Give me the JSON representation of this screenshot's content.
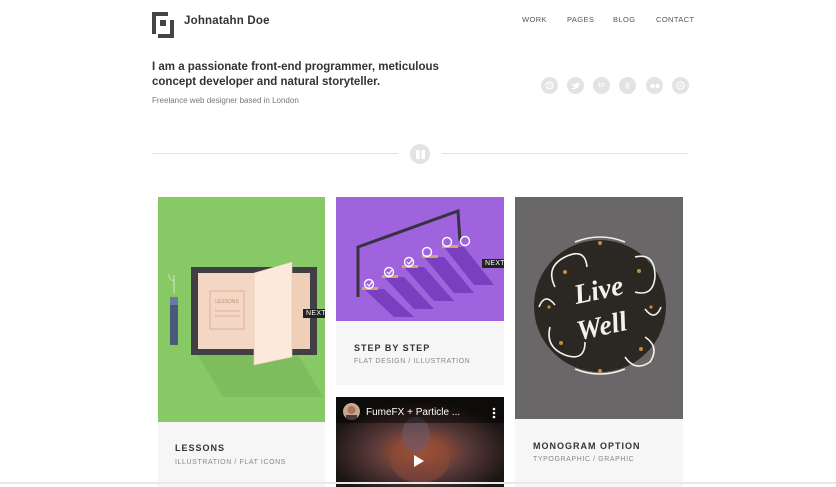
{
  "header": {
    "brand": "Johnatahn Doe",
    "nav": [
      "WORK",
      "PAGES",
      "BLOG",
      "CONTACT"
    ]
  },
  "intro": {
    "headline_1": "I am a passionate front-end programmer, meticulous",
    "headline_2": "concept developer and natural storyteller.",
    "subline": "Freelance web designer based in London"
  },
  "social": [
    "dribbble-icon",
    "twitter-icon",
    "linkedin-icon",
    "google-plus-icon",
    "flickr-icon",
    "pinterest-icon"
  ],
  "cards": [
    {
      "title": "LESSONS",
      "subtitle": "ILLUSTRATION / FLAT ICONS",
      "book_label": "LESSONS",
      "next": "NEXT",
      "bg": "#87c964"
    },
    {
      "title": "STEP BY STEP",
      "subtitle": "FLAT DESIGN / ILLUSTRATION",
      "next": "NEXT",
      "bg": "#9f63dd"
    },
    {
      "title": "MONOGRAM OPTION",
      "subtitle": "TYPOGRAPHIC / GRAPHIC",
      "art_text_1": "Live",
      "art_text_2": "Well",
      "bg": "#6a6769"
    }
  ],
  "video": {
    "title": "FumeFX + Particle ..."
  }
}
